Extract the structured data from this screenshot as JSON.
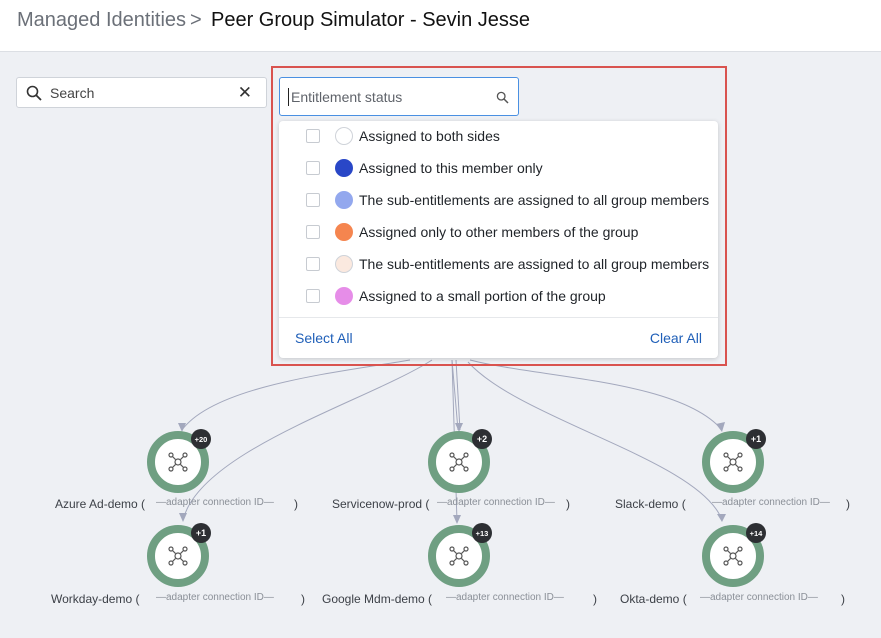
{
  "breadcrumb": {
    "parent": "Managed Identities",
    "separator": ">",
    "current": "Peer Group Simulator - Sevin Jesse"
  },
  "search": {
    "placeholder": "Search",
    "icon": "search-icon",
    "clear_icon": "close-icon"
  },
  "entitlement_filter": {
    "placeholder": "Entitlement status",
    "icon": "search-icon",
    "options": [
      {
        "label": "Assigned to both sides",
        "color": "#ffffff",
        "checked": false
      },
      {
        "label": "Assigned to this member only",
        "color": "#2947c7",
        "checked": false
      },
      {
        "label": "The sub-entitlements are assigned to all group members",
        "color": "#93a8ee",
        "checked": false
      },
      {
        "label": "Assigned only to other members of the group",
        "color": "#f5854f",
        "checked": false
      },
      {
        "label": "The sub-entitlements are assigned to all group members",
        "color": "#fbe9df",
        "checked": false
      },
      {
        "label": "Assigned to a small portion of the group",
        "color": "#e68de8",
        "checked": false
      }
    ],
    "select_all": "Select All",
    "clear_all": "Clear All"
  },
  "graph": {
    "node_color": "#6f9f82",
    "nodes": [
      {
        "name": "Azure Ad-demo (",
        "sub": "—adapter connection ID—",
        "close": ")",
        "badge": "+20"
      },
      {
        "name": "Servicenow-prod (",
        "sub": "—adapter connection ID—",
        "close": ")",
        "badge": "+2"
      },
      {
        "name": "Slack-demo (",
        "sub": "—adapter connection ID—",
        "close": ")",
        "badge": "+1"
      },
      {
        "name": "Workday-demo (",
        "sub": "—adapter connection ID—",
        "close": ")",
        "badge": "+1"
      },
      {
        "name": "Google Mdm-demo (",
        "sub": "—adapter connection ID—",
        "close": ")",
        "badge": "+13"
      },
      {
        "name": "Okta-demo (",
        "sub": "—adapter connection ID—",
        "close": ")",
        "badge": "+14"
      }
    ]
  }
}
